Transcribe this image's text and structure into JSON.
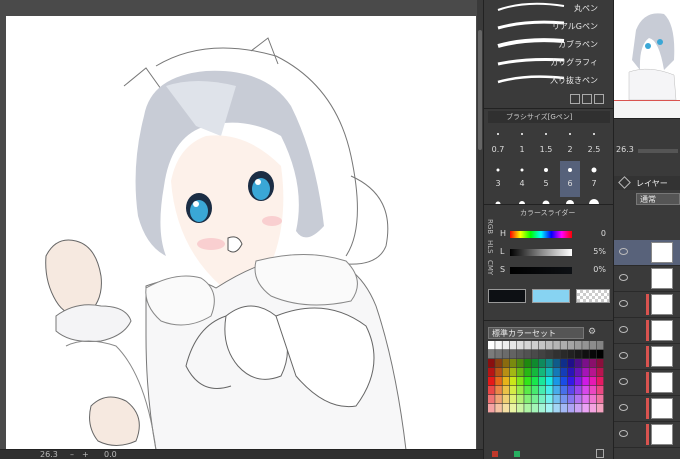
{
  "canvas": {
    "status": {
      "zoom": "26.3",
      "angle": "0.0"
    }
  },
  "brush_panel": {
    "items": [
      {
        "label": "丸ペン"
      },
      {
        "label": "リアルGペン"
      },
      {
        "label": "カブラペン"
      },
      {
        "label": "カリグラフィ"
      },
      {
        "label": "入り抜きペン"
      }
    ]
  },
  "brush_size": {
    "title": "ブラシサイズ[Gペン]",
    "sizes": [
      "0.7",
      "1",
      "1.5",
      "2",
      "2.5",
      "3",
      "4",
      "5",
      "6",
      "7"
    ],
    "selected": "6"
  },
  "color_slider": {
    "title": "カラースライダー",
    "modes": [
      "RGB",
      "HLS",
      "CMY"
    ],
    "sliders": [
      {
        "label": "H",
        "value": "0"
      },
      {
        "label": "L",
        "value": "5%"
      },
      {
        "label": "S",
        "value": "0%"
      }
    ],
    "main_color": "#0d1014",
    "sub_color": "#87d3f2"
  },
  "color_set": {
    "selected": "標準カラーセット"
  },
  "nav_tools": {
    "zoom": "26.3",
    "layer_label": "レイヤー",
    "blend_mode": "通常"
  }
}
